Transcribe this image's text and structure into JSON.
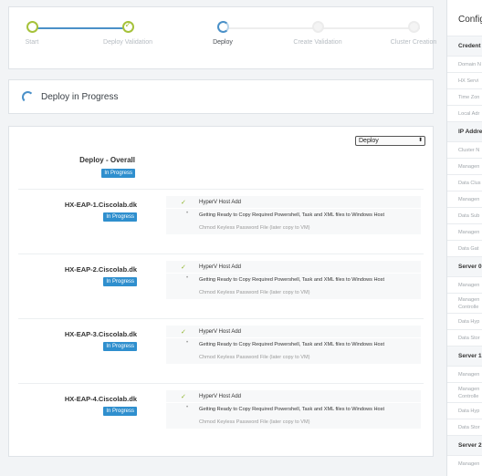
{
  "stepper": {
    "steps": [
      {
        "label": "Start",
        "state": "done"
      },
      {
        "label": "Deploy Validation",
        "state": "done-check"
      },
      {
        "label": "Deploy",
        "state": "current"
      },
      {
        "label": "Create Validation",
        "state": "todo"
      },
      {
        "label": "Cluster Creation",
        "state": "todo"
      }
    ],
    "colors": {
      "done": "#a6c23b",
      "current": "#4a90c8",
      "todo": "#e8e8e8"
    }
  },
  "progress": {
    "title": "Deploy in Progress"
  },
  "detail": {
    "select_value": "Deploy",
    "overall": {
      "label": "Deploy - Overall",
      "status": "In Progress"
    },
    "hosts": [
      {
        "name": "HX-EAP-1.Ciscolab.dk",
        "status": "In Progress",
        "task": "HyperV Host Add",
        "subtasks": [
          "Getting Ready to Copy Required Powershell, Task and XML files to Windows Host",
          "Chmod Keyless Password File (later copy to VM)"
        ]
      },
      {
        "name": "HX-EAP-2.Ciscolab.dk",
        "status": "In Progress",
        "task": "HyperV Host Add",
        "subtasks": [
          "Getting Ready to Copy Required Powershell, Task and XML files to Windows Host",
          "Chmod Keyless Password File (later copy to VM)"
        ]
      },
      {
        "name": "HX-EAP-3.Ciscolab.dk",
        "status": "In Progress",
        "task": "HyperV Host Add",
        "subtasks": [
          "Getting Ready to Copy Required Powershell, Task and XML files to Windows Host",
          "Chmod Keyless Password File (later copy to VM)"
        ]
      },
      {
        "name": "HX-EAP-4.Ciscolab.dk",
        "status": "In Progress",
        "task": "HyperV Host Add",
        "subtasks": [
          "Getting Ready to Copy Required Powershell, Task and XML files to Windows Host",
          "Chmod Keyless Password File (later copy to VM)"
        ]
      }
    ],
    "badge_color": "#2f8fce"
  },
  "config": {
    "title": "Config",
    "items": [
      {
        "type": "section",
        "label": "Credent"
      },
      {
        "type": "field",
        "label": "Domain N"
      },
      {
        "type": "field",
        "label": "HX Servi"
      },
      {
        "type": "field",
        "label": "Time Zon"
      },
      {
        "type": "field",
        "label": "Local Adr"
      },
      {
        "type": "section",
        "label": "IP Addre"
      },
      {
        "type": "field",
        "label": "Cluster N"
      },
      {
        "type": "field",
        "label": "Managen"
      },
      {
        "type": "field",
        "label": "Data Clus"
      },
      {
        "type": "field",
        "label": "Managen"
      },
      {
        "type": "field",
        "label": "Data Sub"
      },
      {
        "type": "field",
        "label": "Managen"
      },
      {
        "type": "field",
        "label": "Data Gat"
      },
      {
        "type": "section",
        "label": "Server 0"
      },
      {
        "type": "field",
        "label": "Managen"
      },
      {
        "type": "field2",
        "label": "Managen Controlle"
      },
      {
        "type": "field",
        "label": "Data Hyp"
      },
      {
        "type": "field",
        "label": "Data Stor"
      },
      {
        "type": "section",
        "label": "Server 1"
      },
      {
        "type": "field",
        "label": "Managen"
      },
      {
        "type": "field2",
        "label": "Managen Controlle"
      },
      {
        "type": "field",
        "label": "Data Hyp"
      },
      {
        "type": "field",
        "label": "Data Stor"
      },
      {
        "type": "section",
        "label": "Server 2"
      },
      {
        "type": "field",
        "label": "Managen"
      }
    ]
  }
}
